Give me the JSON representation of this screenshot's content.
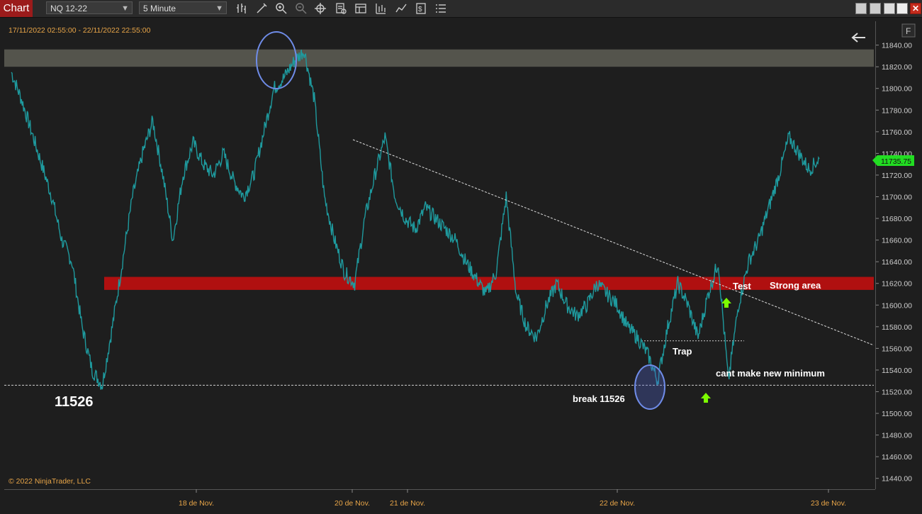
{
  "toolbar": {
    "chart_tab": "Chart",
    "instrument": "NQ 12-22",
    "interval": "5 Minute",
    "close_label": "✕"
  },
  "chart_data": {
    "type": "line",
    "title": "",
    "date_range": "17/11/2022 02:55:00 - 22/11/2022 22:55:00",
    "copyright": "© 2022 NinjaTrader, LLC",
    "y_ticks": [
      11840,
      11820,
      11800,
      11780,
      11760,
      11740,
      11720,
      11700,
      11680,
      11660,
      11640,
      11620,
      11600,
      11580,
      11560,
      11540,
      11520,
      11500,
      11480,
      11460,
      11440
    ],
    "ylim": [
      11430,
      11862
    ],
    "x_ticks": [
      "18 de Nov.",
      "20 de Nov.",
      "21 de Nov.",
      "22 de Nov.",
      "23 de Nov."
    ],
    "last_price": "11735.75",
    "series": [
      {
        "values": [
          11815,
          11790,
          11760,
          11730,
          11700,
          11660,
          11640,
          11580,
          11540,
          11526,
          11580,
          11640,
          11700,
          11740,
          11770,
          11720,
          11660,
          11720,
          11750,
          11730,
          11720,
          11740,
          11715,
          11700,
          11720,
          11760,
          11800,
          11810,
          11825,
          11835,
          11790,
          11700,
          11660,
          11630,
          11620,
          11680,
          11720,
          11755,
          11700,
          11680,
          11670,
          11690,
          11680,
          11670,
          11660,
          11640,
          11625,
          11610,
          11630,
          11700,
          11610,
          11580,
          11570,
          11600,
          11620,
          11600,
          11590,
          11600,
          11620,
          11610,
          11600,
          11580,
          11570,
          11555,
          11530,
          11580,
          11620,
          11600,
          11570,
          11610,
          11640,
          11530,
          11600,
          11640,
          11660,
          11690,
          11720,
          11755,
          11740,
          11725,
          11735
        ]
      }
    ],
    "annotations": {
      "level_label": "11526",
      "break_label": "break 11526",
      "trap_label": "Trap",
      "test_label": "Test",
      "strong_label": "Strong area",
      "minimum_label": "cant make new minimum"
    },
    "zones": {
      "top_zone": [
        11820,
        11836
      ],
      "strong_zone": [
        11614,
        11626
      ],
      "support_level": 11526,
      "trap_level": 11567
    },
    "colors": {
      "series": "#1e9a9e",
      "strong_zone": "#b01010",
      "top_zone": "#5e5e55",
      "arrow": "#7cfc00",
      "circle": "#6f8ce8",
      "last_price_bg": "#22dd22",
      "date_text": "#e8a548"
    }
  }
}
